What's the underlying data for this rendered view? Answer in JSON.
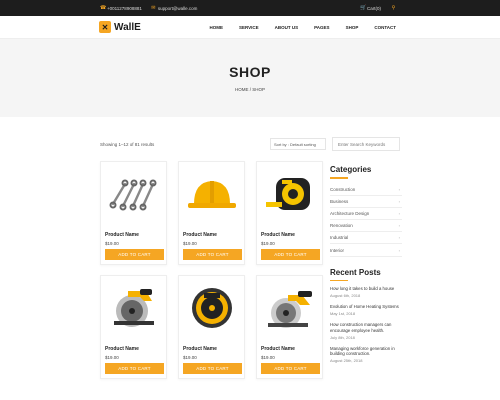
{
  "topbar": {
    "phone": "+0011278908881",
    "email": "support@walle.com",
    "cart": "Cart(0)"
  },
  "brand": {
    "name": "WallE"
  },
  "nav": {
    "items": [
      "HOME",
      "SERVICE",
      "ABOUT US",
      "PAGES",
      "SHOP",
      "CONTACT"
    ]
  },
  "hero": {
    "title": "SHOP",
    "breadcrumb": "HOME / SHOP"
  },
  "toolbar": {
    "results": "Showing 1–12 of 81 results",
    "sort": "Sort by : Default sorting",
    "search_placeholder": "Enter Search Keywords"
  },
  "products": [
    {
      "name": "Product Name",
      "price": "$19.00",
      "button": "ADD TO CART",
      "icon": "wrench-set-icon"
    },
    {
      "name": "Product Name",
      "price": "$19.00",
      "button": "ADD TO CART",
      "icon": "hard-hat-icon"
    },
    {
      "name": "Product Name",
      "price": "$19.00",
      "button": "ADD TO CART",
      "icon": "tape-measure-icon"
    },
    {
      "name": "Product Name",
      "price": "$19.00",
      "button": "ADD TO CART",
      "icon": "circular-saw-icon"
    },
    {
      "name": "Product Name",
      "price": "$19.00",
      "button": "ADD TO CART",
      "icon": "saw-blade-icon"
    },
    {
      "name": "Product Name",
      "price": "$19.00",
      "button": "ADD TO CART",
      "icon": "circular-saw-icon"
    }
  ],
  "sidebar": {
    "categories_title": "Categories",
    "categories": [
      "Construction",
      "Business",
      "Architecture Design",
      "Renovation",
      "Industrial",
      "Interior"
    ],
    "recent_title": "Recent Posts",
    "posts": [
      {
        "title": "How long it takes to build a house",
        "date": "August 6th, 2018"
      },
      {
        "title": "Evolution of Home Heating Systems",
        "date": "May 1st, 2018"
      },
      {
        "title": "How construction managers can encourage employee health.",
        "date": "July 8th, 2018"
      },
      {
        "title": "Managing workforce generation in building construction.",
        "date": "August 25th, 2018"
      }
    ]
  },
  "colors": {
    "accent": "#f5a623",
    "dark": "#1d1d1d"
  }
}
